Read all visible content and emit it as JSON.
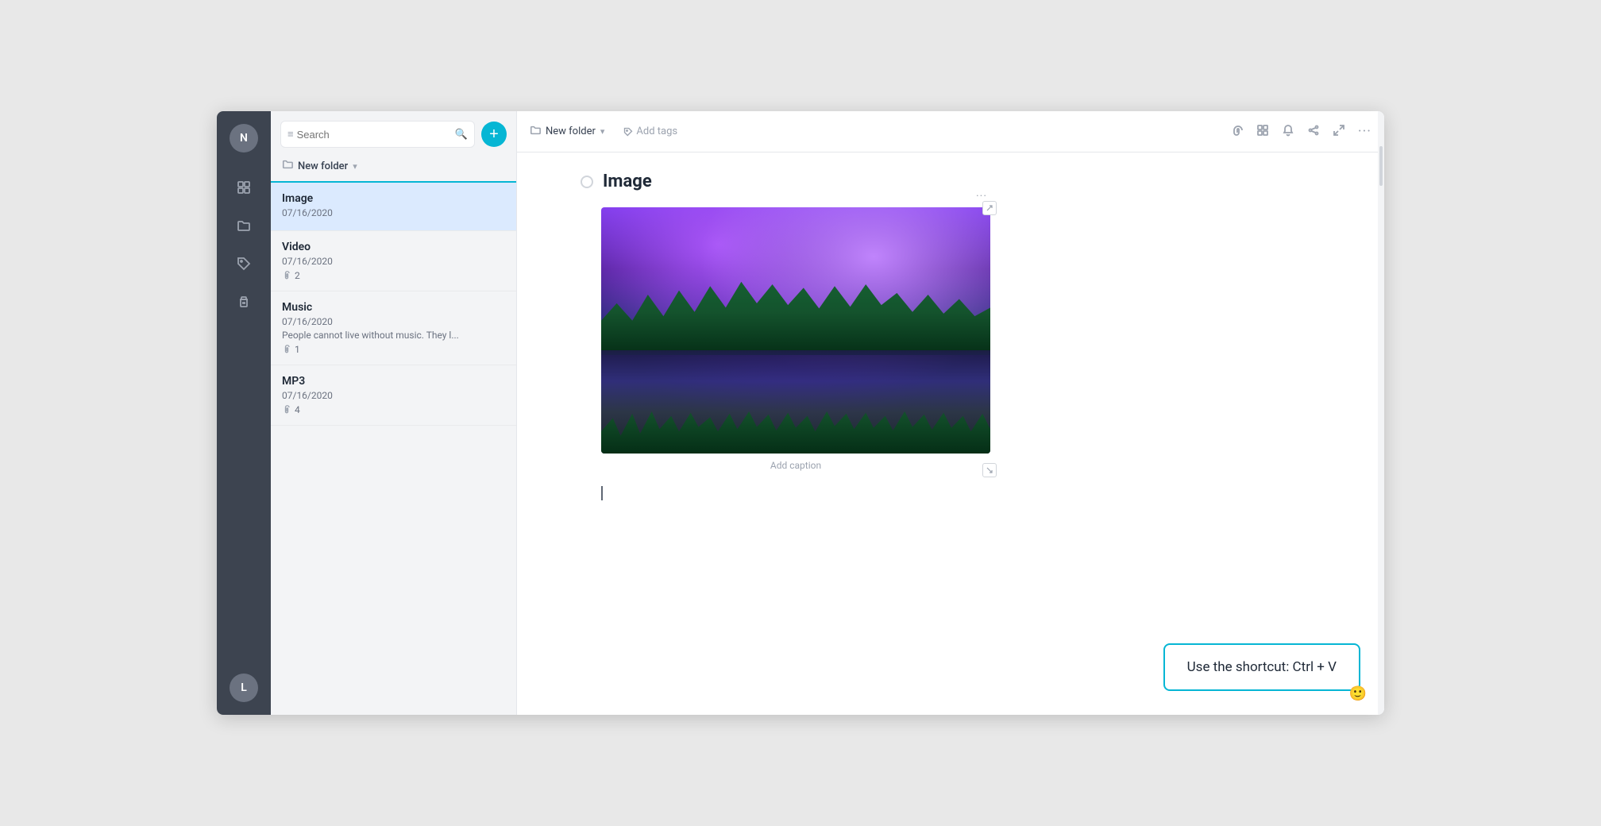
{
  "sidebar": {
    "top_avatar": "N",
    "bottom_avatar": "L",
    "icons": [
      {
        "name": "grid-icon",
        "symbol": "⊞",
        "active": false
      },
      {
        "name": "folder-icon",
        "symbol": "🗂",
        "active": false
      },
      {
        "name": "tag-icon",
        "symbol": "🏷",
        "active": false
      },
      {
        "name": "trash-icon",
        "symbol": "🗑",
        "active": false
      }
    ]
  },
  "notes_panel": {
    "search_placeholder": "Search",
    "add_button_label": "+",
    "folder_name": "New folder",
    "notes": [
      {
        "id": "image",
        "title": "Image",
        "date": "07/16/2020",
        "preview": "",
        "attachments": null,
        "active": true
      },
      {
        "id": "video",
        "title": "Video",
        "date": "07/16/2020",
        "preview": "",
        "attachments": "2",
        "active": false
      },
      {
        "id": "music",
        "title": "Music",
        "date": "07/16/2020",
        "preview": "People cannot live without music. They l...",
        "attachments": "1",
        "active": false
      },
      {
        "id": "mp3",
        "title": "MP3",
        "date": "07/16/2020",
        "preview": "",
        "attachments": "4",
        "active": false
      }
    ]
  },
  "toolbar": {
    "breadcrumb_folder": "New folder",
    "add_tags_label": "Add tags",
    "icons": {
      "attachment": "📎",
      "grid": "⊞",
      "bell": "🔔",
      "share": "🔗",
      "expand": "⛶",
      "more": "···"
    }
  },
  "note": {
    "title": "Image",
    "image_caption": "Add caption",
    "more_menu": "···"
  },
  "shortcut_tooltip": {
    "text": "Use the shortcut: Ctrl + V"
  },
  "emoji_button": "🙂"
}
